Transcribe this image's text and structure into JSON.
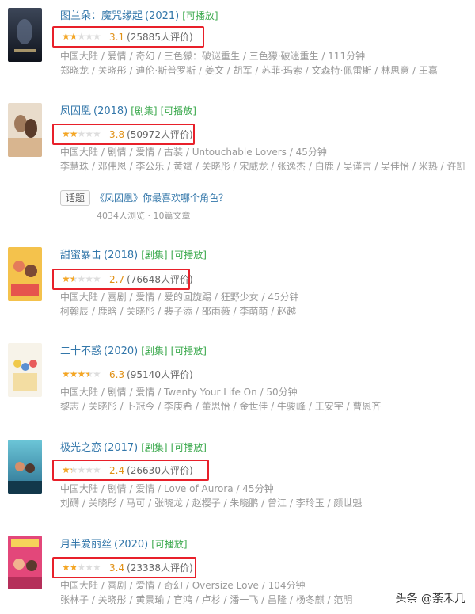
{
  "colors": {
    "link": "#3377aa",
    "playable": "#3ba94d",
    "star": "#f5a623",
    "highlight_box": "#e8202a"
  },
  "items": [
    {
      "title": "图兰朵：魔咒缘起",
      "year": "(2021)",
      "series_tag": "",
      "play_tag": "[可播放]",
      "rating": 3.1,
      "score": "3.1",
      "votes": "(25885人评价)",
      "meta": "中国大陆 / 爱情 / 奇幻 / 三色獴：破谜重生 / 三色獴·破迷重生 / 111分钟",
      "cast": "郑晓龙 / 关晓彤 / 迪伦·斯普罗斯 / 姜文 / 胡军 / 苏菲·玛索 / 文森特·佩雷斯 / 林思意 / 王嘉"
    },
    {
      "title": "凤囚凰",
      "year": "(2018)",
      "series_tag": "[剧集]",
      "play_tag": "[可播放]",
      "rating": 3.8,
      "score": "3.8",
      "votes": "(50972人评价)",
      "meta": "中国大陆 / 剧情 / 爱情 / 古装 / Untouchable Lovers / 45分钟",
      "cast": "李慧珠 / 邓伟恩 / 李公乐 / 黄斌 / 关晓彤 / 宋威龙 / 张逸杰 / 白鹿 / 吴谨言 / 吴佳怡 / 米热 / 许凯"
    },
    {
      "title": "甜蜜暴击",
      "year": "(2018)",
      "series_tag": "[剧集]",
      "play_tag": "[可播放]",
      "rating": 2.7,
      "score": "2.7",
      "votes": "(76648人评价)",
      "meta": "中国大陆 / 喜剧 / 爱情 / 爱的回旋踢 / 狂野少女 / 45分钟",
      "cast": "柯翰辰 / 鹿晗 / 关晓彤 / 裴子添 / 邵雨薇 / 李萌萌 / 赵越"
    },
    {
      "title": "二十不惑",
      "year": "(2020)",
      "series_tag": "[剧集]",
      "play_tag": "[可播放]",
      "rating": 6.3,
      "score": "6.3",
      "votes": "(95140人评价)",
      "meta": "中国大陆 / 剧情 / 爱情 / Twenty Your Life On / 50分钟",
      "cast": "黎志 / 关晓彤 / 卜冠今 / 李庚希 / 董思怡 / 金世佳 / 牛骏峰 / 王安宇 / 曹恩齐"
    },
    {
      "title": "极光之恋",
      "year": "(2017)",
      "series_tag": "[剧集]",
      "play_tag": "[可播放]",
      "rating": 2.4,
      "score": "2.4",
      "votes": "(26630人评价)",
      "meta": "中国大陆 / 剧情 / 爱情 / Love of Aurora / 45分钟",
      "cast": "刘礴 / 关晓彤 / 马可 / 张晓龙 / 赵樱子 / 朱晓鹏 / 曾江 / 李玲玉 / 颜世魁"
    },
    {
      "title": "月半爱丽丝",
      "year": "(2020)",
      "series_tag": "",
      "play_tag": "[可播放]",
      "rating": 3.4,
      "score": "3.4",
      "votes": "(23338人评价)",
      "meta": "中国大陆 / 喜剧 / 爱情 / 奇幻 / Oversize Love / 104分钟",
      "cast": "张林子 / 关晓彤 / 黄景瑜 / 官鸿 / 卢杉 / 潘一飞 / 昌隆 / 杨冬麒 / 范明"
    }
  ],
  "topic": {
    "badge": "话题",
    "link": "《凤囚凰》你最喜欢哪个角色？",
    "stats": "4034人浏览 · 10篇文章"
  },
  "icons": {
    "star": "star-icon"
  },
  "watermark": "头条 @荼禾几"
}
